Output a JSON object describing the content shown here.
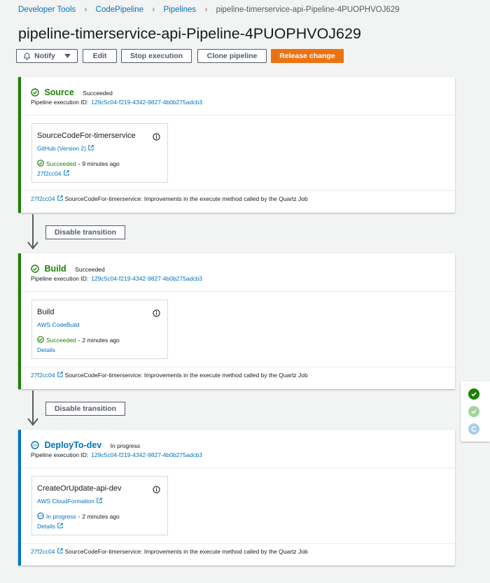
{
  "breadcrumb": [
    "Developer Tools",
    "CodePipeline",
    "Pipelines"
  ],
  "breadcrumb_current": "pipeline-timerservice-api-Pipeline-4PUOPHVOJ629",
  "page_title": "pipeline-timerservice-api-Pipeline-4PUOPHVOJ629",
  "toolbar": {
    "notify": "Notify",
    "edit": "Edit",
    "stop": "Stop execution",
    "clone": "Clone pipeline",
    "release": "Release change"
  },
  "colors": {
    "success": "#1d8102",
    "in_progress": "#0073bb",
    "accent": "#ec7211",
    "link": "#0073bb"
  },
  "stages": [
    {
      "name": "Source",
      "status": "Succeeded",
      "exec_label": "Pipeline execution ID:",
      "exec_id": "129c5c04-f219-4342-9827-4b0b275adcb3",
      "action": {
        "name": "SourceCodeFor-timerservice",
        "provider": "GitHub (Version 2)",
        "status": "Succeeded",
        "time": "9 minutes ago",
        "link": "27f2cc04"
      },
      "commit_id": "27f2cc04",
      "commit_msg": "SourceCodeFor-timerservice: Improvements in the execute method called by the Quartz Job"
    },
    {
      "name": "Build",
      "status": "Succeeded",
      "exec_label": "Pipeline execution ID:",
      "exec_id": "129c5c04-f219-4342-9827-4b0b275adcb3",
      "action": {
        "name": "Build",
        "provider": "AWS CodeBuild",
        "status": "Succeeded",
        "time": "2 minutes ago",
        "link": "Details"
      },
      "commit_id": "27f2cc04",
      "commit_msg": "SourceCodeFor-timerservice: Improvements in the execute method called by the Quartz Job"
    },
    {
      "name": "DeployTo-dev",
      "status": "In progress",
      "exec_label": "Pipeline execution ID:",
      "exec_id": "129c5c04-f219-4342-9827-4b0b275adcb3",
      "action": {
        "name": "CreateOrUpdate-api-dev",
        "provider": "AWS CloudFormation",
        "status": "In progress",
        "time": "2 minutes ago",
        "link": "Details"
      },
      "commit_id": "27f2cc04",
      "commit_msg": "SourceCodeFor-timerservice: Improvements in the execute method called by the Quartz Job"
    }
  ],
  "transitions": [
    {
      "label": "Disable transition"
    },
    {
      "label": "Disable transition"
    }
  ],
  "status_icons": [
    "check-circle-icon",
    "check-circle-icon",
    "in-progress-icon"
  ]
}
